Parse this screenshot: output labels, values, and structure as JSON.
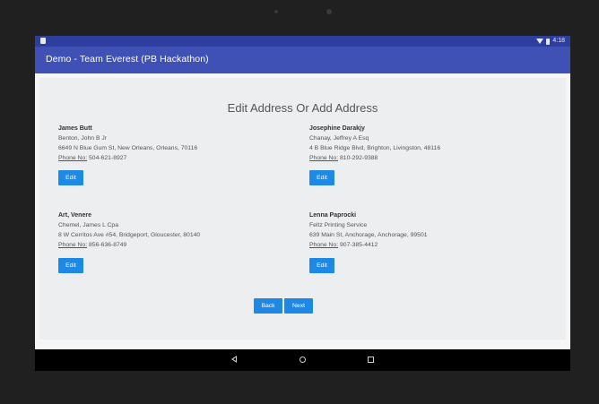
{
  "status_bar": {
    "time": "4:18"
  },
  "app_bar": {
    "title": "Demo - Team Everest (PB Hackathon)"
  },
  "page": {
    "heading": "Edit Address Or Add Address"
  },
  "addresses": [
    {
      "name": "James Butt",
      "contact": "Benton, John B Jr",
      "address": "6649 N Blue Gum St, New Orleans, Orleans, 70116",
      "phone_label": "Phone No:",
      "phone": " 504-621-8927",
      "edit_label": "Edit"
    },
    {
      "name": "Josephine Darakjy",
      "contact": "Chanay, Jeffrey A Esq",
      "address": "4 B Blue Ridge Blvd, Brighton, Livingston, 48116",
      "phone_label": "Phone No:",
      "phone": " 810-292-9388",
      "edit_label": "Edit"
    },
    {
      "name": "Art, Venere",
      "contact": "Chemel, James L Cpa",
      "address": "8 W Cerritos Ave #54, Bridgeport, Gloucester, 80140",
      "phone_label": "Phone No:",
      "phone": " 856-636-8749",
      "edit_label": "Edit"
    },
    {
      "name": "Lenna Paprocki",
      "contact": "Feltz Printing Service",
      "address": "639 Main St, Anchorage, Anchorage, 99501",
      "phone_label": "Phone No:",
      "phone": " 907-385-4412",
      "edit_label": "Edit"
    }
  ],
  "pagination": {
    "back_label": "Back",
    "next_label": "Next"
  },
  "colors": {
    "app_bar": "#3f51b5",
    "status_bar": "#2e3e9e",
    "button": "#1e88e5",
    "content_bg": "#eceef0"
  },
  "icons": [
    "sd-card-icon",
    "wifi-icon",
    "battery-icon",
    "back-nav-icon",
    "home-nav-icon",
    "recents-nav-icon"
  ]
}
